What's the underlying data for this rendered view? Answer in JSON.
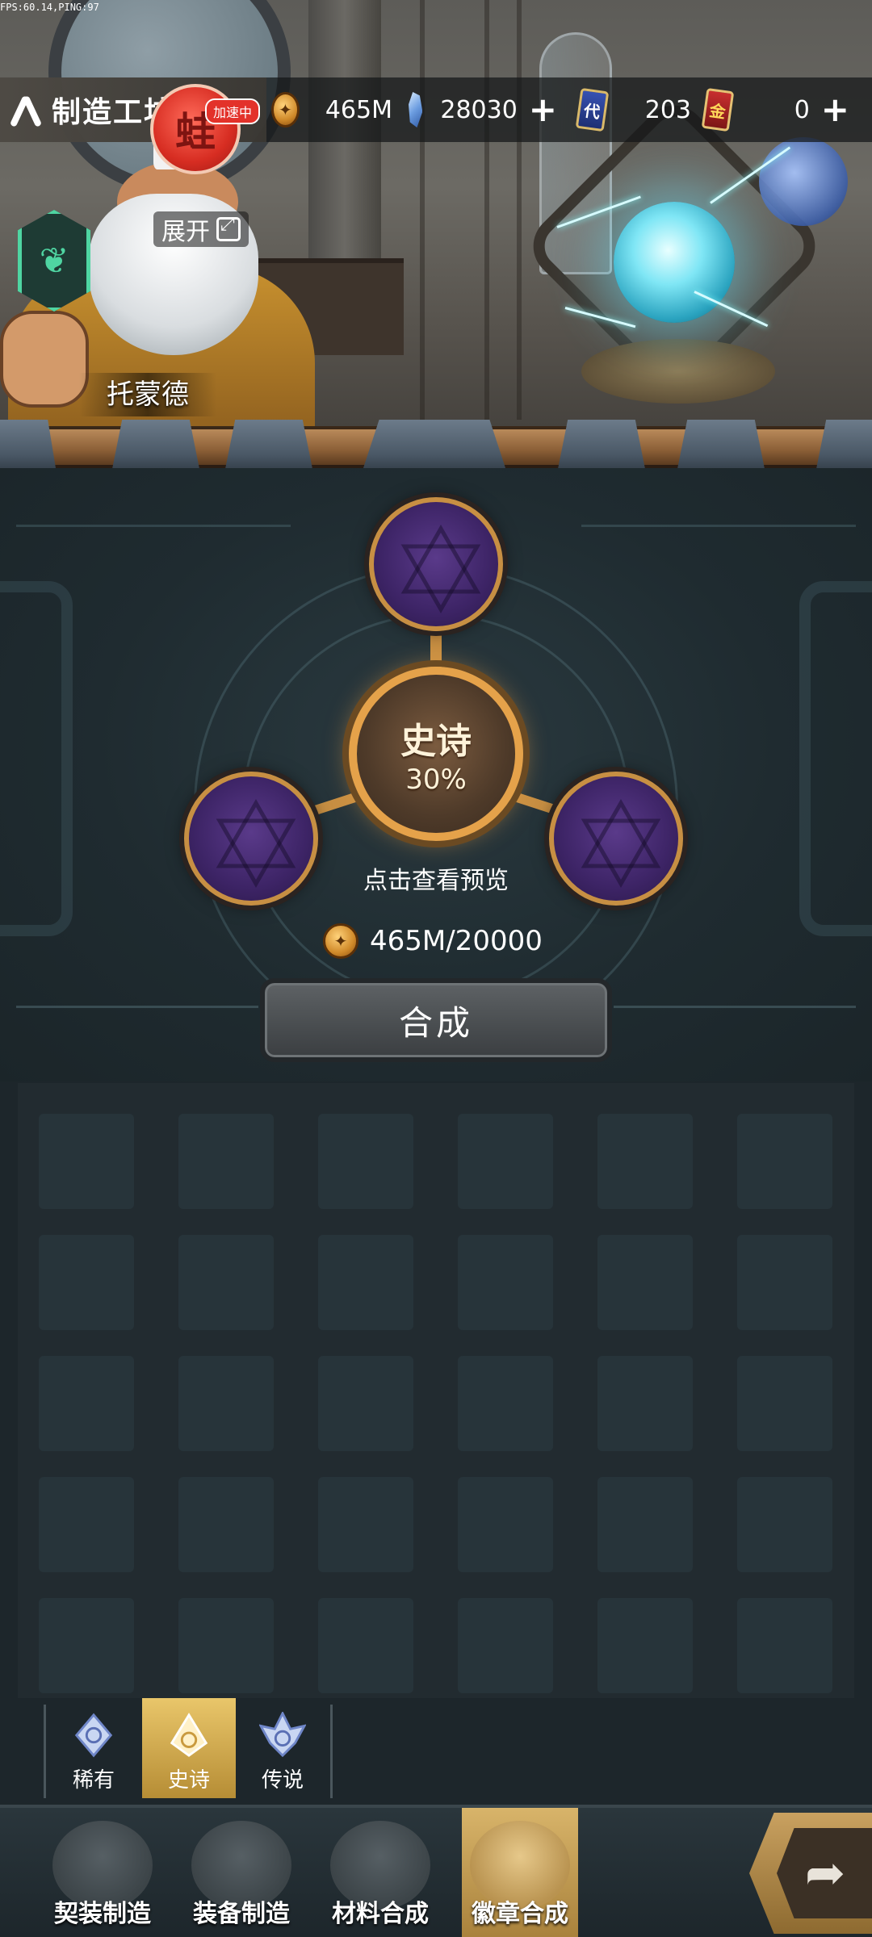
{
  "status": {
    "fps_text": "FPS:60.14,PING:97"
  },
  "header": {
    "title": "制造工坊",
    "speedup_glyph": "蛙",
    "speedup_tag": "加速中",
    "expand_label": "展开",
    "hero_name": "托蒙德"
  },
  "resources": [
    {
      "icon": "coin-icon",
      "value": "465M",
      "addable": false
    },
    {
      "icon": "crystal-icon",
      "value": "28030",
      "addable": true
    },
    {
      "icon": "voucher-card-icon",
      "glyph": "代",
      "value": "203",
      "addable": false
    },
    {
      "icon": "gold-card-icon",
      "glyph": "金",
      "value": "0",
      "addable": true
    }
  ],
  "synthesis": {
    "center_name": "史诗",
    "center_rate": "30%",
    "preview_hint": "点击查看预览",
    "cost": "465M/20000",
    "craft_label": "合成"
  },
  "rarity_tabs": [
    {
      "label": "稀有",
      "active": false
    },
    {
      "label": "史诗",
      "active": true
    },
    {
      "label": "传说",
      "active": false
    }
  ],
  "bottom_nav": [
    {
      "label": "契装制造",
      "icon": "claw-icon",
      "active": false
    },
    {
      "label": "装备制造",
      "icon": "helmet-icon",
      "active": false
    },
    {
      "label": "材料合成",
      "icon": "ore-icon",
      "active": false
    },
    {
      "label": "徽章合成",
      "icon": "badge-icon",
      "active": true
    }
  ],
  "share_icon": "share-arrow-icon",
  "colors": {
    "accent_gold": "#e5a24a",
    "slot_purple": "#3d2466",
    "bg_dark": "#1d262b"
  }
}
